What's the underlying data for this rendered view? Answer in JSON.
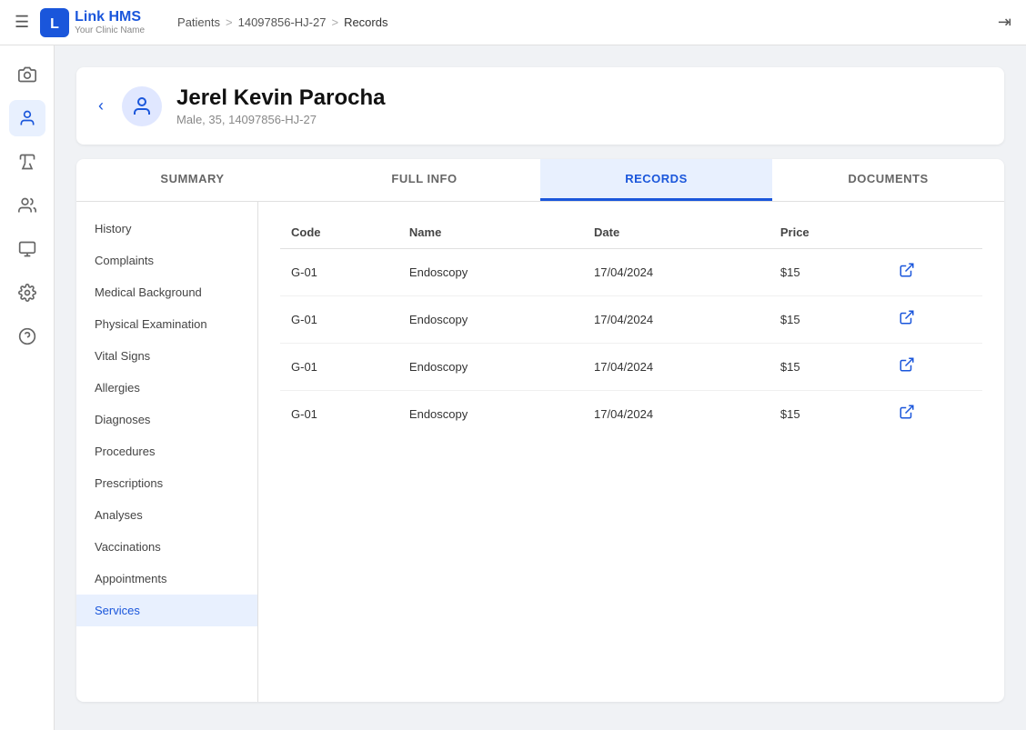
{
  "topnav": {
    "hamburger_icon": "☰",
    "logo_name": "Link HMS",
    "logo_sub": "Your Clinic Name",
    "breadcrumb": {
      "patients_label": "Patients",
      "sep1": ">",
      "patient_id": "14097856-HJ-27",
      "sep2": ">",
      "current": "Records"
    },
    "logout_icon": "⇥"
  },
  "sidebar": {
    "items": [
      {
        "id": "camera",
        "icon": "📷",
        "active": false
      },
      {
        "id": "person",
        "icon": "👤",
        "active": true
      },
      {
        "id": "flask",
        "icon": "🧪",
        "active": false
      },
      {
        "id": "group",
        "icon": "👥",
        "active": false
      },
      {
        "id": "monitor",
        "icon": "🖥",
        "active": false
      },
      {
        "id": "gear",
        "icon": "⚙",
        "active": false
      },
      {
        "id": "help",
        "icon": "❓",
        "active": false
      }
    ]
  },
  "patient": {
    "name": "Jerel Kevin Parocha",
    "meta": "Male, 35, 14097856-HJ-27"
  },
  "tabs": [
    {
      "id": "summary",
      "label": "SUMMARY",
      "active": false
    },
    {
      "id": "full-info",
      "label": "FULL INFO",
      "active": false
    },
    {
      "id": "records",
      "label": "RECORDS",
      "active": true
    },
    {
      "id": "documents",
      "label": "DOCUMENTS",
      "active": false
    }
  ],
  "left_nav": [
    {
      "id": "history",
      "label": "History",
      "active": false
    },
    {
      "id": "complaints",
      "label": "Complaints",
      "active": false
    },
    {
      "id": "medical-background",
      "label": "Medical Background",
      "active": false
    },
    {
      "id": "physical-examination",
      "label": "Physical Examination",
      "active": false
    },
    {
      "id": "vital-signs",
      "label": "Vital Signs",
      "active": false
    },
    {
      "id": "allergies",
      "label": "Allergies",
      "active": false
    },
    {
      "id": "diagnoses",
      "label": "Diagnoses",
      "active": false
    },
    {
      "id": "procedures",
      "label": "Procedures",
      "active": false
    },
    {
      "id": "prescriptions",
      "label": "Prescriptions",
      "active": false
    },
    {
      "id": "analyses",
      "label": "Analyses",
      "active": false
    },
    {
      "id": "vaccinations",
      "label": "Vaccinations",
      "active": false
    },
    {
      "id": "appointments",
      "label": "Appointments",
      "active": false
    },
    {
      "id": "services",
      "label": "Services",
      "active": true
    }
  ],
  "records_table": {
    "columns": [
      "Code",
      "Name",
      "Date",
      "Price"
    ],
    "rows": [
      {
        "code": "G-01",
        "name": "Endoscopy",
        "date": "17/04/2024",
        "price": "$15"
      },
      {
        "code": "G-01",
        "name": "Endoscopy",
        "date": "17/04/2024",
        "price": "$15"
      },
      {
        "code": "G-01",
        "name": "Endoscopy",
        "date": "17/04/2024",
        "price": "$15"
      },
      {
        "code": "G-01",
        "name": "Endoscopy",
        "date": "17/04/2024",
        "price": "$15"
      }
    ]
  },
  "colors": {
    "brand": "#1a56db",
    "active_tab_bg": "#e8f0fe",
    "active_nav_bg": "#e8f0fe"
  }
}
